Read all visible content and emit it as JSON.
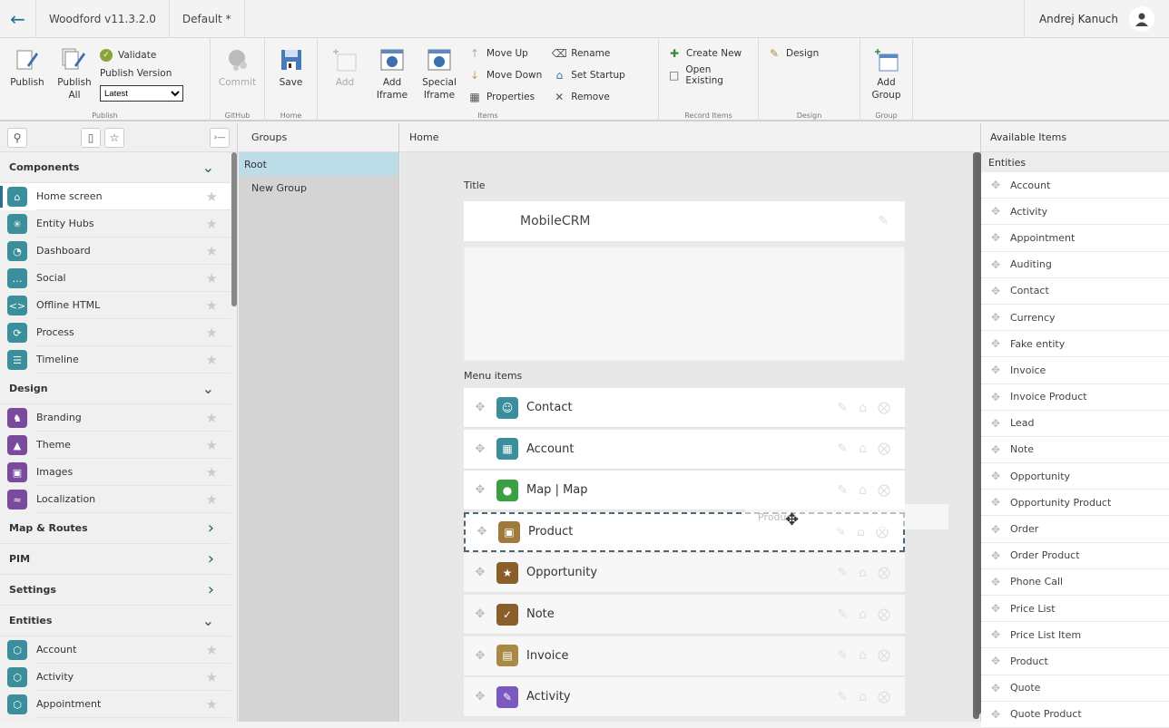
{
  "topbar": {
    "back_icon": "arrow-left-icon",
    "app_title": "Woodford v11.3.2.0",
    "project": "Default *",
    "user_name": "Andrej Kanuch"
  },
  "ribbon": {
    "publish_group": {
      "label": "Publish",
      "publish": "Publish",
      "publish_all": "Publish All",
      "validate": "Validate",
      "publish_version_label": "Publish Version",
      "publish_version_value": "Latest"
    },
    "github_group": {
      "label": "GitHub",
      "commit": "Commit"
    },
    "home_group": {
      "label": "Home",
      "save": "Save"
    },
    "items_group": {
      "label": "Items",
      "add": "Add",
      "add_iframe": "Add Iframe",
      "special_iframe": "Special Iframe",
      "move_up": "Move Up",
      "move_down": "Move Down",
      "properties": "Properties",
      "rename": "Rename",
      "set_startup": "Set Startup",
      "remove": "Remove"
    },
    "record_items_group": {
      "label": "Record Items",
      "create_new": "Create New",
      "open_existing": "Open Existing"
    },
    "design_group": {
      "label": "Design",
      "design": "Design"
    },
    "group_group": {
      "label": "Group",
      "add_group": "Add Group"
    }
  },
  "sidebar": {
    "sections": [
      {
        "label": "Components",
        "expanded": true,
        "items": [
          {
            "label": "Home screen",
            "icon": "home-icon",
            "active": true
          },
          {
            "label": "Entity Hubs",
            "icon": "hub-icon"
          },
          {
            "label": "Dashboard",
            "icon": "gauge-icon"
          },
          {
            "label": "Social",
            "icon": "chat-icon"
          },
          {
            "label": "Offline HTML",
            "icon": "html-icon"
          },
          {
            "label": "Process",
            "icon": "process-icon"
          },
          {
            "label": "Timeline",
            "icon": "timeline-icon"
          }
        ]
      },
      {
        "label": "Design",
        "expanded": true,
        "items": [
          {
            "label": "Branding",
            "icon": "branding-icon"
          },
          {
            "label": "Theme",
            "icon": "theme-icon"
          },
          {
            "label": "Images",
            "icon": "image-icon"
          },
          {
            "label": "Localization",
            "icon": "localization-icon"
          }
        ]
      },
      {
        "label": "Map & Routes",
        "expanded": false,
        "items": []
      },
      {
        "label": "PIM",
        "expanded": false,
        "items": []
      },
      {
        "label": "Settings",
        "expanded": false,
        "items": []
      },
      {
        "label": "Entities",
        "expanded": true,
        "items": [
          {
            "label": "Account",
            "icon": "entity-cube-icon"
          },
          {
            "label": "Activity",
            "icon": "entity-cube-icon"
          },
          {
            "label": "Appointment",
            "icon": "entity-cube-icon"
          }
        ]
      }
    ]
  },
  "groups": {
    "header": "Groups",
    "items": [
      {
        "label": "Root",
        "selected": true
      },
      {
        "label": "New Group",
        "selected": false
      }
    ]
  },
  "main": {
    "header": "Home",
    "title_label": "Title",
    "title_value": "MobileCRM",
    "menu_label": "Menu items",
    "drag_ghost_label": "Product",
    "menu_items": [
      {
        "label": "Contact",
        "icon": "contact-icon",
        "color": "#3b8f9c"
      },
      {
        "label": "Account",
        "icon": "account-icon",
        "color": "#3b8f9c"
      },
      {
        "label": "Map | Map",
        "icon": "map-pin-icon",
        "color": "#3aa043"
      },
      {
        "label": "Product",
        "icon": "product-icon",
        "color": "#a07a3a",
        "dragging": true
      },
      {
        "label": "Opportunity",
        "icon": "opportunity-icon",
        "color": "#8a5f2a"
      },
      {
        "label": "Note",
        "icon": "note-icon",
        "color": "#8a5f2a"
      },
      {
        "label": "Invoice",
        "icon": "invoice-icon",
        "color": "#a88a45"
      },
      {
        "label": "Activity",
        "icon": "activity-icon",
        "color": "#7a5ac0"
      }
    ]
  },
  "available": {
    "header": "Available Items",
    "section": "Entities",
    "items": [
      "Account",
      "Activity",
      "Appointment",
      "Auditing",
      "Contact",
      "Currency",
      "Fake entity",
      "Invoice",
      "Invoice Product",
      "Lead",
      "Note",
      "Opportunity",
      "Opportunity Product",
      "Order",
      "Order Product",
      "Phone Call",
      "Price List",
      "Price List Item",
      "Product",
      "Quote",
      "Quote Product"
    ]
  }
}
